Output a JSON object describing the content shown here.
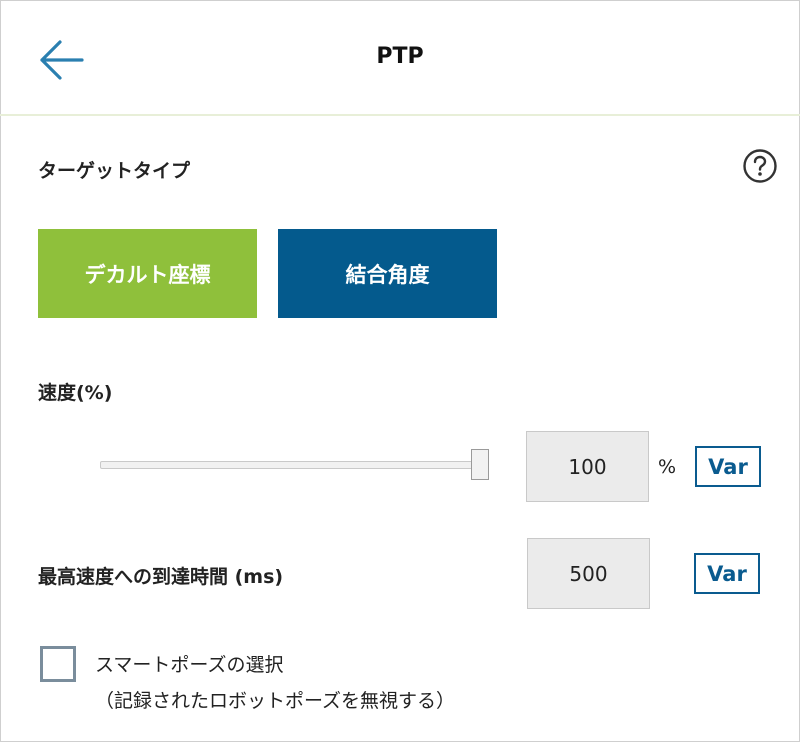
{
  "header": {
    "title": "PTP",
    "back_icon": "arrow-left-icon"
  },
  "target_type": {
    "label": "ターゲットタイプ",
    "help_icon": "question-circle-icon",
    "options": [
      {
        "label": "デカルト座標",
        "color": "#8fc03b"
      },
      {
        "label": "結合角度",
        "color": "#045a8d"
      }
    ]
  },
  "speed": {
    "label": "速度(%)",
    "value": "100",
    "unit": "%",
    "var_label": "Var",
    "slider_fraction": 1.0
  },
  "accel_time": {
    "label": "最高速度への到達時間 (ms)",
    "value": "500",
    "var_label": "Var"
  },
  "smart_pose": {
    "label_line1": "スマートポーズの選択",
    "label_line2": "（記録されたロボットポーズを無視する）",
    "checked": false
  }
}
